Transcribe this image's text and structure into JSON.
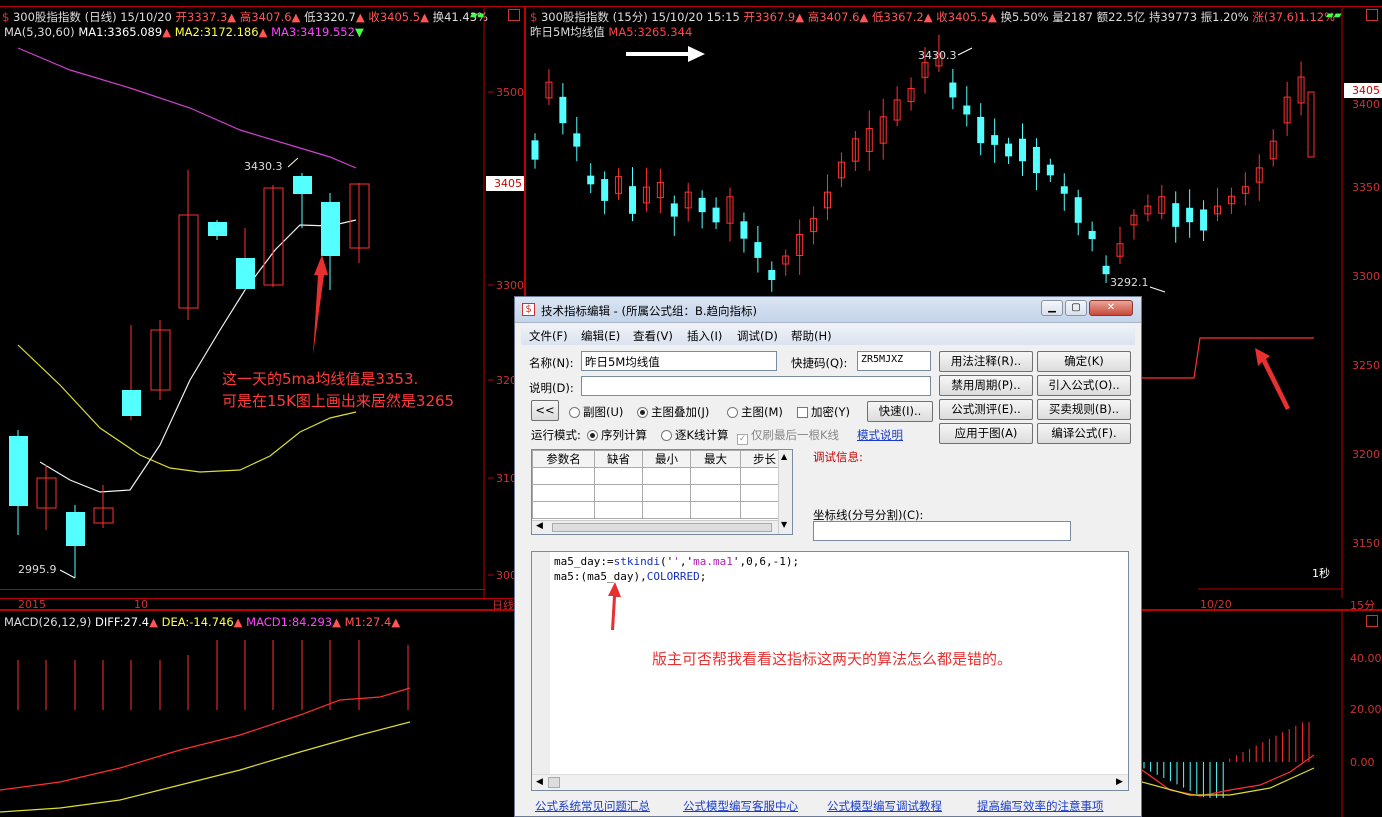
{
  "left_chart": {
    "header": {
      "title": "300股指指数 (日线)",
      "date": "15/10/20",
      "open": "开3337.3",
      "high": "高3407.6",
      "low": "低3320.7",
      "close": "收3405.5",
      "turnover": "换41.43%"
    },
    "ma_line": {
      "label": "MA(5,30,60)",
      "ma1": "MA1:3365.089",
      "ma2": "MA2:3172.186",
      "ma3": "MA3:3419.552"
    },
    "price_ticks": [
      "3500",
      "3405",
      "3300",
      "320",
      "310",
      "300"
    ],
    "annotations": {
      "high": "3430.3",
      "low": "2995.9"
    },
    "x_labels": [
      "2015",
      "10"
    ],
    "period_label": "日线",
    "note_line1": "这一天的5ma均线值是3353.",
    "note_line2": "可是在15K图上画出来居然是3265"
  },
  "right_chart": {
    "header": {
      "title": "300股指指数 (15分)",
      "datetime": "15/10/20 15:15",
      "open": "开3367.9",
      "high": "高3407.6",
      "low": "低3367.2",
      "close": "收3405.5",
      "turnover": "换5.50%",
      "volume": "量2187",
      "amount": "额22.5亿",
      "hold": "持39773",
      "amplitude": "振1.20%",
      "change": "涨(37.6)1.12%"
    },
    "indicator_line": {
      "name": "昨日5M均线值",
      "value": "MA5:3265.344"
    },
    "price_ticks": [
      "3405",
      "3400",
      "3350",
      "3300",
      "3250",
      "3200",
      "3150"
    ],
    "annotations": {
      "high": "3430.3",
      "low": "3292.1"
    },
    "time_label": "1秒",
    "x_label": "10/20",
    "period_label": "15分"
  },
  "macd": {
    "label": "MACD(26,12,9)",
    "diff": "DIFF:27.4",
    "dea": "DEA:-14.746",
    "macd1": "MACD1:84.293",
    "m1": "M1:27.4",
    "ticks": [
      "40.00",
      "20.00",
      "0.00"
    ]
  },
  "dialog": {
    "title": "技术指标编辑 - (所属公式组：B.趋向指标)",
    "title_buttons": [
      "▁",
      "▢",
      "✕"
    ],
    "menu": [
      "文件(F)",
      "编辑(E)",
      "查看(V)",
      "插入(I)",
      "调试(D)",
      "帮助(H)"
    ],
    "name_label": "名称(N):",
    "name_value": "昨日5M均线值",
    "shortcut_label": "快捷码(Q):",
    "shortcut_value": "ZR5MJXZ",
    "desc_label": "说明(D):",
    "desc_value": "",
    "collapse_btn": "<<",
    "draw_options": [
      "副图(U)",
      "主图叠加(J)",
      "主图(M)"
    ],
    "encrypt_label": "加密(Y)",
    "fast_btn": "快速(I)..",
    "run_mode_label": "运行模式:",
    "run_modes": [
      "序列计算",
      "逐K线计算"
    ],
    "refresh_last_label": "仅刷最后一根K线",
    "mode_help_link": "模式说明",
    "buttons": {
      "usage": "用法注释(R)..",
      "ok": "确定(K)",
      "ban_period": "禁用周期(P)..",
      "import": "引入公式(O)..",
      "evaluate": "公式测评(E)..",
      "trade_rules": "买卖规则(B)..",
      "apply": "应用于图(A)",
      "compile": "编译公式(F)."
    },
    "param_headers": [
      "参数名",
      "缺省",
      "最小",
      "最大",
      "步长"
    ],
    "debug_label": "调试信息:",
    "coord_label": "坐标线(分号分割)(C):",
    "coord_value": "",
    "code_line1_a": "ma5_day:=",
    "code_line1_fn": "stkindi",
    "code_line1_b": "('",
    "code_line1_str1": "'",
    "code_line1_c": ",'",
    "code_line1_str2": "ma.ma1",
    "code_line1_d": "',0,6,-1);",
    "code_line2_a": "ma5:(ma5_day),",
    "code_line2_kw": "COLORRED",
    "code_line2_b": ";",
    "question": "版主可否帮我看看这指标这两天的算法怎么都是错的。",
    "links": [
      "公式系统常见问题汇总",
      "公式模型编写客服中心",
      "公式模型编写调试教程",
      "提高编写效率的注意事项"
    ]
  },
  "colors": {
    "bull": "#ff3030",
    "bear": "#54ffff",
    "ma1": "#ffffff",
    "ma2": "#ffff40",
    "ma3": "#ff40ff",
    "separator": "#b00000",
    "link": "#1a3cc8"
  }
}
